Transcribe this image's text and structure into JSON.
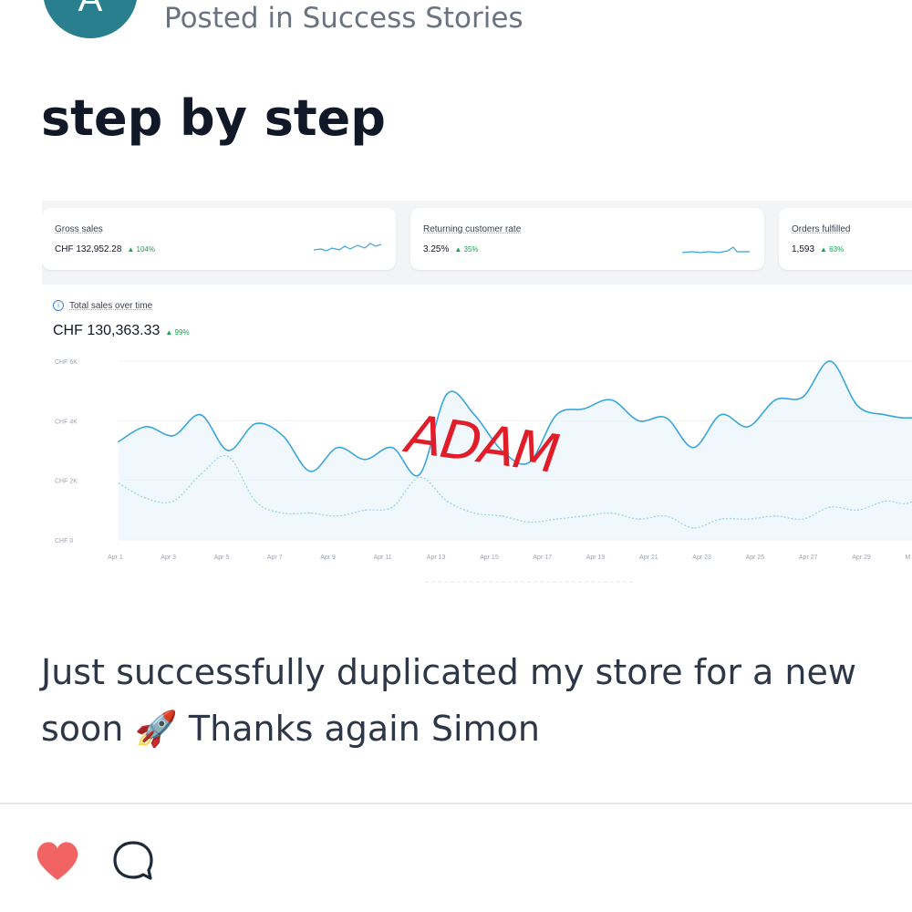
{
  "post": {
    "avatar_letter": "A",
    "posted_in": "Posted in Success Stories",
    "title": "step by step",
    "body_line1": "Just successfully duplicated my store for a new",
    "body_line2_start": "soon",
    "body_emoji": "🚀",
    "body_line2_end": "Thanks again Simon"
  },
  "screenshot": {
    "annotation": "ADAM",
    "cards": [
      {
        "label": "Gross sales",
        "value": "CHF 132,952.28",
        "change": "▲ 104%"
      },
      {
        "label": "Returning customer rate",
        "value": "3.25%",
        "change": "▲ 35%"
      },
      {
        "label": "Orders fulfilled",
        "value": "1,593",
        "change": "▲ 63%"
      }
    ],
    "chart_title": "Total sales over time",
    "chart_total": "CHF 130,363.33",
    "chart_change": "▲ 99%"
  },
  "chart_data": {
    "type": "line",
    "title": "Total sales over time",
    "xlabel": "",
    "ylabel": "",
    "y_ticks": [
      "CHF 6K",
      "CHF 4K",
      "CHF 2K",
      "CHF 0"
    ],
    "ylim": [
      0,
      6000
    ],
    "x_ticks": [
      "Apr 1",
      "Apr 3",
      "Apr 5",
      "Apr 7",
      "Apr 9",
      "Apr 11",
      "Apr 13",
      "Apr 15",
      "Apr 17",
      "Apr 19",
      "Apr 21",
      "Apr 23",
      "Apr 25",
      "Apr 27",
      "Apr 29",
      "M"
    ],
    "x": [
      1,
      2,
      3,
      4,
      5,
      6,
      7,
      8,
      9,
      10,
      11,
      12,
      13,
      14,
      15,
      16,
      17,
      18,
      19,
      20,
      21,
      22,
      23,
      24,
      25,
      26,
      27,
      28,
      29,
      30,
      31
    ],
    "series": [
      {
        "values": [
          3300,
          3800,
          3500,
          4200,
          3000,
          3900,
          3500,
          2300,
          3100,
          2700,
          3100,
          2200,
          4900,
          4200,
          3000,
          2600,
          4200,
          4400,
          4700,
          4000,
          4100,
          3100,
          4200,
          3800,
          4700,
          4800,
          6000,
          4500,
          4200,
          4100,
          4400
        ]
      },
      {
        "values": [
          1900,
          1400,
          1300,
          2200,
          2800,
          1300,
          900,
          900,
          800,
          1000,
          1100,
          2100,
          1300,
          900,
          800,
          600,
          700,
          800,
          900,
          700,
          800,
          400,
          700,
          700,
          800,
          700,
          1100,
          1000,
          1300,
          1300,
          2600
        ]
      }
    ],
    "grid": true,
    "legend": "none"
  },
  "colors": {
    "avatar": "#2a7f8f",
    "line_current": "#3aa6d9",
    "line_previous": "#9fd3ea",
    "annotation": "#e11d2a",
    "heart": "#f26464",
    "change_positive": "#16a34a"
  },
  "icons": {
    "like": "heart-icon",
    "comment": "comment-bubble-icon",
    "info": "info-icon"
  }
}
